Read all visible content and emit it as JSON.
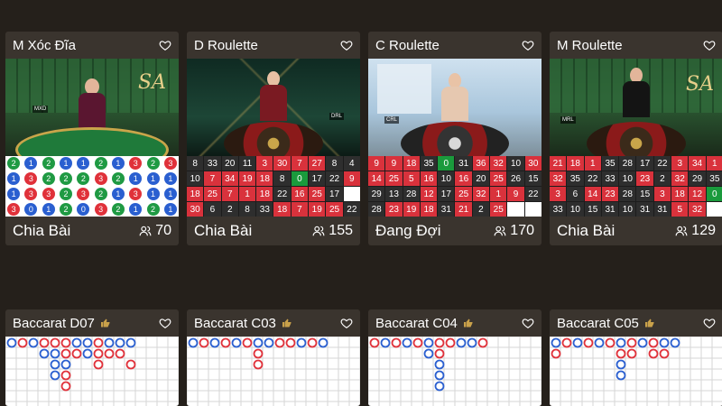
{
  "colors": {
    "page_bg": "#25201b",
    "card_bg": "#3a342e",
    "red": "#d9323c",
    "dark": "#2e2e2e",
    "green": "#1a9a3c",
    "blue": "#2a5fd0",
    "road_red": "#e0313a",
    "road_blue": "#2a5fd0"
  },
  "tables": [
    {
      "title": "M Xóc Đĩa",
      "status": "Chia Bài",
      "players": "70",
      "video_tag": "MXD",
      "icon": "heart-icon",
      "bead_rows": [
        [
          [
            "2",
            "g"
          ],
          [
            "1",
            "b"
          ],
          [
            "2",
            "g"
          ],
          [
            "1",
            "b"
          ],
          [
            "1",
            "b"
          ],
          [
            "2",
            "g"
          ],
          [
            "1",
            "b"
          ],
          [
            "3",
            "r"
          ],
          [
            "2",
            "g"
          ],
          [
            "3",
            "r"
          ]
        ],
        [
          [
            "1",
            "b"
          ],
          [
            "3",
            "r"
          ],
          [
            "2",
            "g"
          ],
          [
            "2",
            "g"
          ],
          [
            "2",
            "g"
          ],
          [
            "3",
            "r"
          ],
          [
            "2",
            "g"
          ],
          [
            "1",
            "b"
          ],
          [
            "1",
            "b"
          ],
          [
            "1",
            "b"
          ]
        ],
        [
          [
            "1",
            "b"
          ],
          [
            "3",
            "r"
          ],
          [
            "3",
            "r"
          ],
          [
            "2",
            "g"
          ],
          [
            "3",
            "r"
          ],
          [
            "2",
            "g"
          ],
          [
            "1",
            "b"
          ],
          [
            "3",
            "r"
          ],
          [
            "1",
            "b"
          ],
          [
            "1",
            "b"
          ]
        ],
        [
          [
            "3",
            "r"
          ],
          [
            "0",
            "b"
          ],
          [
            "1",
            "b"
          ],
          [
            "2",
            "g"
          ],
          [
            "0",
            "b"
          ],
          [
            "3",
            "r"
          ],
          [
            "2",
            "g"
          ],
          [
            "1",
            "b"
          ],
          [
            "2",
            "g"
          ],
          [
            "1",
            "b"
          ]
        ]
      ]
    },
    {
      "title": "D Roulette",
      "status": "Chia Bài",
      "players": "155",
      "video_tag": "DRL",
      "icon": "heart-icon",
      "numbers": [
        [
          [
            "8",
            "d"
          ],
          [
            "33",
            "d"
          ],
          [
            "20",
            "d"
          ],
          [
            "11",
            "d"
          ],
          [
            "3",
            "r"
          ],
          [
            "30",
            "r"
          ],
          [
            "7",
            "r"
          ],
          [
            "27",
            "r"
          ],
          [
            "8",
            "d"
          ],
          [
            "4",
            "d"
          ]
        ],
        [
          [
            "10",
            "d"
          ],
          [
            "7",
            "r"
          ],
          [
            "34",
            "r"
          ],
          [
            "19",
            "r"
          ],
          [
            "18",
            "r"
          ],
          [
            "8",
            "d"
          ],
          [
            "0",
            "g"
          ],
          [
            "17",
            "d"
          ],
          [
            "22",
            "d"
          ],
          [
            "9",
            "r"
          ]
        ],
        [
          [
            "18",
            "r"
          ],
          [
            "25",
            "r"
          ],
          [
            "7",
            "r"
          ],
          [
            "1",
            "r"
          ],
          [
            "18",
            "r"
          ],
          [
            "22",
            "d"
          ],
          [
            "16",
            "r"
          ],
          [
            "25",
            "r"
          ],
          [
            "17",
            "d"
          ],
          [
            "",
            ""
          ]
        ],
        [
          [
            "30",
            "r"
          ],
          [
            "6",
            "d"
          ],
          [
            "2",
            "d"
          ],
          [
            "8",
            "d"
          ],
          [
            "33",
            "d"
          ],
          [
            "18",
            "r"
          ],
          [
            "7",
            "r"
          ],
          [
            "19",
            "r"
          ],
          [
            "25",
            "r"
          ],
          [
            "22",
            "d"
          ]
        ]
      ]
    },
    {
      "title": "C Roulette",
      "status": "Đang Đợi",
      "players": "170",
      "video_tag": "CRL",
      "icon": "heart-icon",
      "numbers": [
        [
          [
            "9",
            "r"
          ],
          [
            "9",
            "r"
          ],
          [
            "18",
            "r"
          ],
          [
            "35",
            "d"
          ],
          [
            "0",
            "g"
          ],
          [
            "31",
            "d"
          ],
          [
            "36",
            "r"
          ],
          [
            "32",
            "r"
          ],
          [
            "10",
            "d"
          ],
          [
            "30",
            "r"
          ]
        ],
        [
          [
            "14",
            "r"
          ],
          [
            "25",
            "r"
          ],
          [
            "5",
            "r"
          ],
          [
            "16",
            "r"
          ],
          [
            "10",
            "d"
          ],
          [
            "16",
            "r"
          ],
          [
            "20",
            "d"
          ],
          [
            "25",
            "r"
          ],
          [
            "26",
            "d"
          ],
          [
            "15",
            "d"
          ]
        ],
        [
          [
            "29",
            "d"
          ],
          [
            "13",
            "d"
          ],
          [
            "28",
            "d"
          ],
          [
            "12",
            "r"
          ],
          [
            "17",
            "d"
          ],
          [
            "25",
            "r"
          ],
          [
            "32",
            "r"
          ],
          [
            "1",
            "r"
          ],
          [
            "9",
            "r"
          ],
          [
            "22",
            "d"
          ]
        ],
        [
          [
            "28",
            "d"
          ],
          [
            "23",
            "r"
          ],
          [
            "19",
            "r"
          ],
          [
            "18",
            "r"
          ],
          [
            "31",
            "d"
          ],
          [
            "21",
            "r"
          ],
          [
            "2",
            "d"
          ],
          [
            "25",
            "r"
          ],
          [
            "",
            ""
          ],
          [
            "",
            ""
          ]
        ]
      ]
    },
    {
      "title": "M Roulette",
      "status": "Chia Bài",
      "players": "129",
      "video_tag": "MRL",
      "icon": "heart-icon",
      "numbers": [
        [
          [
            "21",
            "r"
          ],
          [
            "18",
            "r"
          ],
          [
            "1",
            "r"
          ],
          [
            "35",
            "d"
          ],
          [
            "28",
            "d"
          ],
          [
            "17",
            "d"
          ],
          [
            "22",
            "d"
          ],
          [
            "3",
            "r"
          ],
          [
            "34",
            "r"
          ],
          [
            "1",
            "r"
          ]
        ],
        [
          [
            "32",
            "r"
          ],
          [
            "35",
            "d"
          ],
          [
            "22",
            "d"
          ],
          [
            "33",
            "d"
          ],
          [
            "10",
            "d"
          ],
          [
            "23",
            "r"
          ],
          [
            "2",
            "d"
          ],
          [
            "32",
            "r"
          ],
          [
            "29",
            "d"
          ],
          [
            "35",
            "d"
          ]
        ],
        [
          [
            "3",
            "r"
          ],
          [
            "6",
            "d"
          ],
          [
            "14",
            "r"
          ],
          [
            "23",
            "r"
          ],
          [
            "28",
            "d"
          ],
          [
            "15",
            "d"
          ],
          [
            "3",
            "r"
          ],
          [
            "18",
            "r"
          ],
          [
            "12",
            "r"
          ],
          [
            "0",
            "g"
          ]
        ],
        [
          [
            "33",
            "d"
          ],
          [
            "10",
            "d"
          ],
          [
            "15",
            "d"
          ],
          [
            "31",
            "d"
          ],
          [
            "10",
            "d"
          ],
          [
            "31",
            "d"
          ],
          [
            "31",
            "d"
          ],
          [
            "5",
            "r"
          ],
          [
            "32",
            "r"
          ],
          [
            "",
            ""
          ]
        ]
      ]
    }
  ],
  "baccarat": [
    {
      "title": "Baccarat D07",
      "icon": "thumbs-up-icon"
    },
    {
      "title": "Baccarat C03",
      "icon": "thumbs-up-icon"
    },
    {
      "title": "Baccarat C04",
      "icon": "thumbs-up-icon"
    },
    {
      "title": "Baccarat C05",
      "icon": "thumbs-up-icon"
    }
  ]
}
